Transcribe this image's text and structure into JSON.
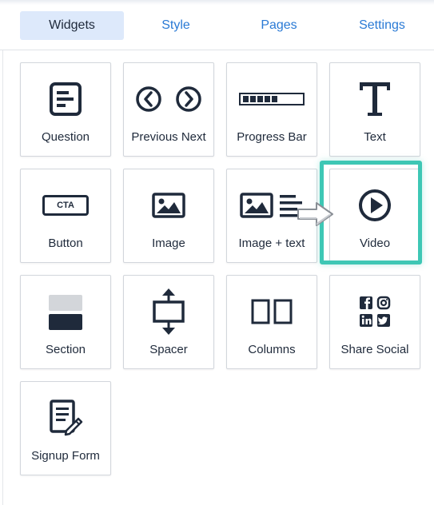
{
  "tabs": [
    {
      "label": "Widgets",
      "active": true
    },
    {
      "label": "Style",
      "active": false
    },
    {
      "label": "Pages",
      "active": false
    },
    {
      "label": "Settings",
      "active": false
    }
  ],
  "widgets": [
    {
      "label": "Question",
      "icon": "question-icon"
    },
    {
      "label": "Previous Next",
      "icon": "previous-next-icon"
    },
    {
      "label": "Progress Bar",
      "icon": "progress-bar-icon"
    },
    {
      "label": "Text",
      "icon": "text-t-icon"
    },
    {
      "label": "Button",
      "icon": "cta-button-icon",
      "icon_text": "CTA"
    },
    {
      "label": "Image",
      "icon": "image-icon"
    },
    {
      "label": "Image + text",
      "icon": "image-text-icon"
    },
    {
      "label": "Video",
      "icon": "play-icon",
      "highlighted": true
    },
    {
      "label": "Section",
      "icon": "section-icon"
    },
    {
      "label": "Spacer",
      "icon": "spacer-icon"
    },
    {
      "label": "Columns",
      "icon": "columns-icon"
    },
    {
      "label": "Share Social",
      "icon": "social-icons"
    },
    {
      "label": "Signup Form",
      "icon": "signup-form-icon"
    }
  ],
  "colors": {
    "accent_tab": "#2a7ad5",
    "active_tab_bg": "#dde9fb",
    "highlight": "#3ec7b5",
    "icon": "#1f2a3b"
  }
}
